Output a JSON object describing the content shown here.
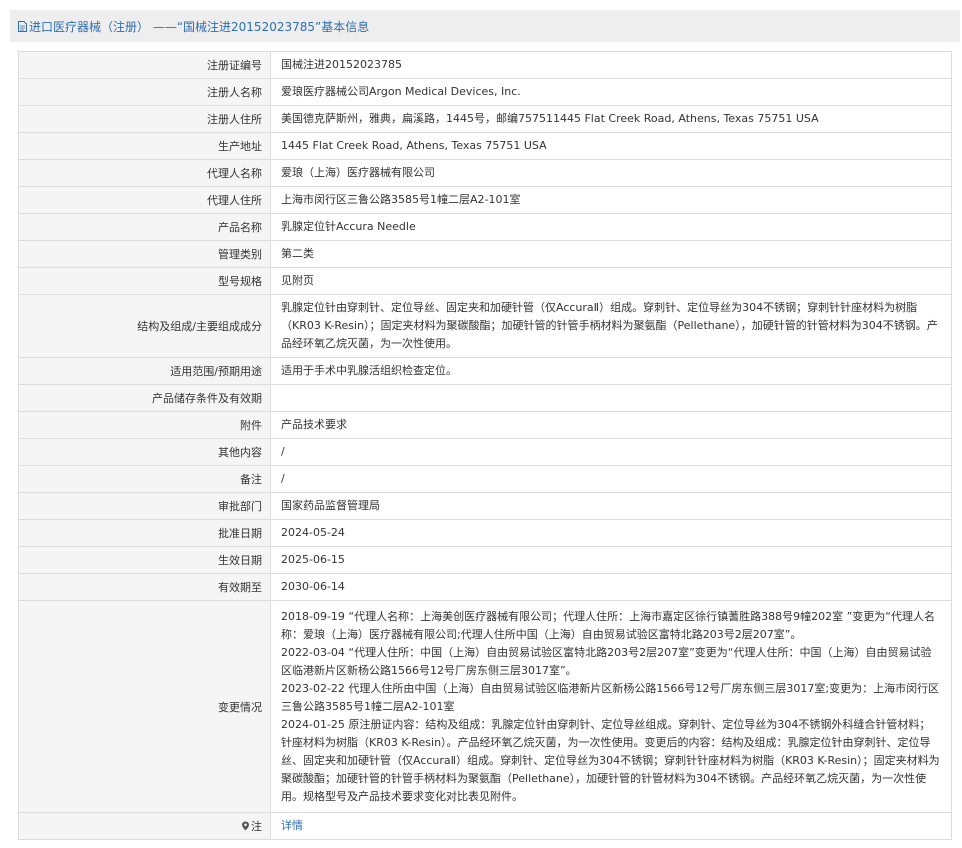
{
  "title": "进口医疗器械（注册） ——“国械注进20152023785”基本信息",
  "rows": [
    {
      "label": "注册证编号",
      "value": "国械注进20152023785"
    },
    {
      "label": "注册人名称",
      "value": "爱琅医疗器械公司Argon Medical Devices, Inc."
    },
    {
      "label": "注册人住所",
      "value": "美国德克萨斯州，雅典，扁溪路，1445号，邮编757511445 Flat Creek Road, Athens, Texas 75751 USA"
    },
    {
      "label": "生产地址",
      "value": "1445 Flat Creek Road, Athens, Texas 75751 USA"
    },
    {
      "label": "代理人名称",
      "value": "爱琅（上海）医疗器械有限公司"
    },
    {
      "label": "代理人住所",
      "value": "上海市闵行区三鲁公路3585号1幢二层A2-101室"
    },
    {
      "label": "产品名称",
      "value": "乳腺定位针Accura Needle"
    },
    {
      "label": "管理类别",
      "value": "第二类"
    },
    {
      "label": "型号规格",
      "value": "见附页"
    },
    {
      "label": "结构及组成/主要组成成分",
      "value": "乳腺定位针由穿刺针、定位导丝、固定夹和加硬针管（仅AccuraⅡ）组成。穿刺针、定位导丝为304不锈钢；穿刺针针座材料为树脂（KR03 K-Resin）；固定夹材料为聚碳酸酯；加硬针管的针管手柄材料为聚氨酯（Pellethane），加硬针管的针管材料为304不锈钢。产品经环氧乙烷灭菌，为一次性使用。"
    },
    {
      "label": "适用范围/预期用途",
      "value": "适用于手术中乳腺活组织检查定位。"
    },
    {
      "label": "产品储存条件及有效期",
      "value": ""
    },
    {
      "label": "附件",
      "value": "产品技术要求"
    },
    {
      "label": "其他内容",
      "value": "/"
    },
    {
      "label": "备注",
      "value": "/"
    },
    {
      "label": "审批部门",
      "value": "国家药品监督管理局"
    },
    {
      "label": "批准日期",
      "value": "2024-05-24"
    },
    {
      "label": "生效日期",
      "value": "2025-06-15"
    },
    {
      "label": "有效期至",
      "value": "2030-06-14"
    }
  ],
  "changes": {
    "label": "变更情况",
    "entries": [
      "2018-09-19 “代理人名称：上海美创医疗器械有限公司；代理人住所：上海市嘉定区徐行镇蓍胜路388号9幢202室 ”变更为“代理人名称：爱琅（上海）医疗器械有限公司;代理人住所中国（上海）自由贸易试验区富特北路203号2层207室”。",
      "2022-03-04 “代理人住所：中国（上海）自由贸易试验区富特北路203号2层207室”变更为“代理人住所：中国（上海）自由贸易试验区临港新片区新杨公路1566号12号厂房东侧三层3017室”。",
      "2023-02-22 代理人住所由中国（上海）自由贸易试验区临港新片区新杨公路1566号12号厂房东侧三层3017室;变更为：上海市闵行区三鲁公路3585号1幢二层A2-101室",
      "2024-01-25 原注册证内容：结构及组成：乳腺定位针由穿刺针、定位导丝组成。穿刺针、定位导丝为304不锈钢外科缝合针管材料；针座材料为树脂（KR03 K-Resin）。产品经环氧乙烷灭菌，为一次性使用。变更后的内容：结构及组成：乳腺定位针由穿刺针、定位导丝、固定夹和加硬针管（仅AccuraⅡ）组成。穿刺针、定位导丝为304不锈钢；穿刺针针座材料为树脂（KR03 K-Resin）；固定夹材料为聚碳酸酯；加硬针管的针管手柄材料为聚氨酯（Pellethane），加硬针管的针管材料为304不锈钢。产品经环氧乙烷灭菌，为一次性使用。规格型号及产品技术要求变化对比表见附件。"
    ]
  },
  "note": {
    "label": "注",
    "link_text": "详情"
  },
  "colors": {
    "link": "#2d6eb4",
    "label_bg": "#f5f5f5",
    "border": "#dcdcdc",
    "title_bg": "#eeeeee"
  }
}
